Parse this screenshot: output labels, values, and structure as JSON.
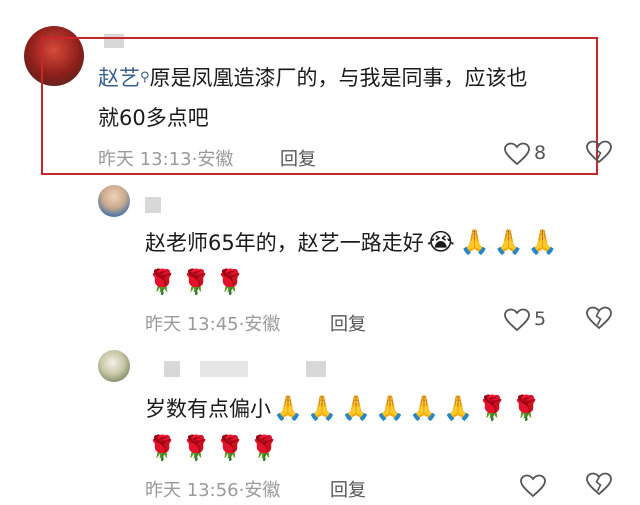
{
  "comments": [
    {
      "username": "赵艺",
      "text_line1": "原是凤凰造漆厂的，与我是同事，应该也",
      "text_line2": "就60多点吧",
      "time": "昨天 13:13",
      "location": "安徽",
      "reply_label": "回复",
      "likes": "8"
    },
    {
      "text": "赵老师65年的，赵艺一路走好",
      "emoji_row1": [
        "😭",
        "🙏",
        "🙏",
        "🙏"
      ],
      "emoji_row2": [
        "🌹",
        "🌹",
        "🌹"
      ],
      "time": "昨天 13:45",
      "location": "安徽",
      "reply_label": "回复",
      "likes": "5"
    },
    {
      "text": "岁数有点偏小",
      "emoji_row1": [
        "🙏",
        "🙏",
        "🙏",
        "🙏",
        "🙏",
        "🙏",
        "🌹",
        "🌹"
      ],
      "emoji_row2": [
        "🌹",
        "🌹",
        "🌹",
        "🌹"
      ],
      "time": "昨天 13:56",
      "location": "安徽",
      "reply_label": "回复",
      "likes": ""
    }
  ],
  "colors": {
    "highlight_border": "#c9252b",
    "username": "#3a5f92"
  },
  "icons": {
    "verified": "search-badge-icon",
    "like": "heart-icon",
    "dislike": "broken-heart-icon"
  }
}
